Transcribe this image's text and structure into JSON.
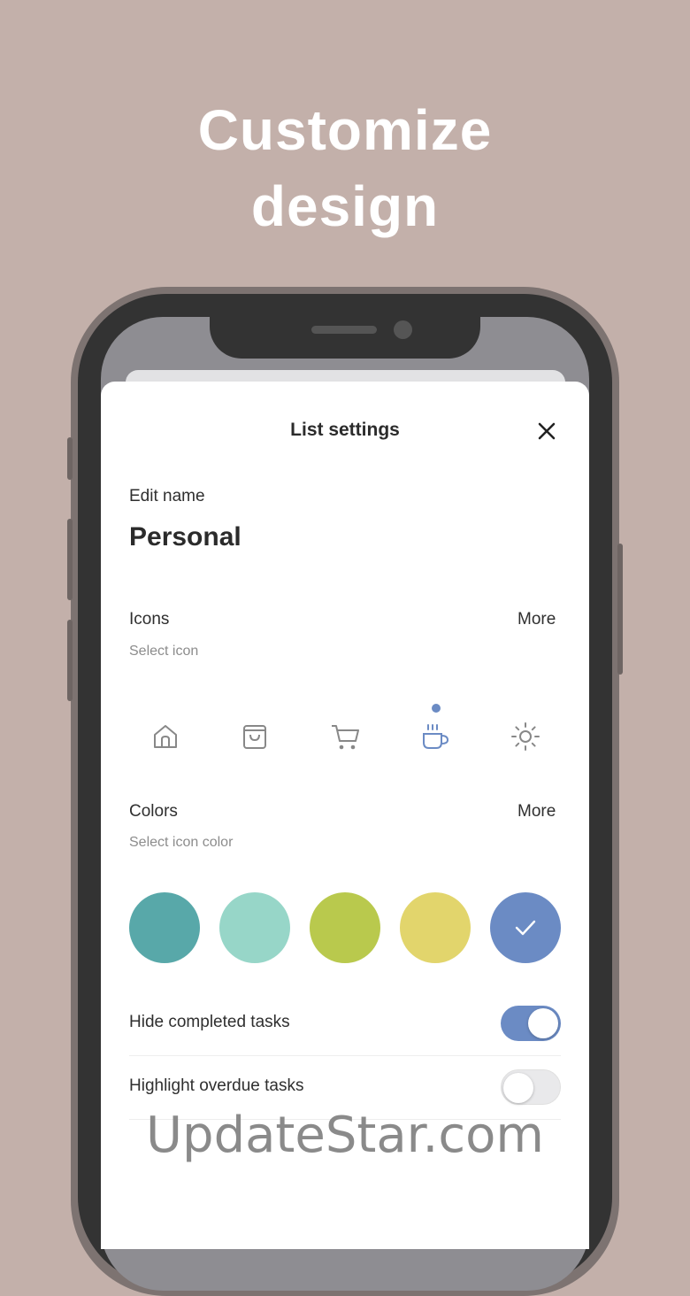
{
  "headline": {
    "line1": "Customize",
    "line2": "design"
  },
  "sheet": {
    "title": "List settings"
  },
  "edit_name": {
    "label": "Edit name",
    "value": "Personal"
  },
  "icons": {
    "label": "Icons",
    "more": "More",
    "hint": "Select icon",
    "items": [
      "home-icon",
      "bag-icon",
      "cart-icon",
      "cup-icon",
      "sun-icon"
    ],
    "selected": "cup-icon"
  },
  "colors": {
    "label": "Colors",
    "more": "More",
    "hint": "Select icon color",
    "swatches": [
      "#58a8a9",
      "#97d6c8",
      "#b9c94d",
      "#e2d56c",
      "#6b8bc4"
    ],
    "selected": "#6b8bc4"
  },
  "toggles": {
    "hide_completed": {
      "label": "Hide completed tasks",
      "on": true
    },
    "highlight_overdue": {
      "label": "Highlight overdue tasks",
      "on": false
    }
  },
  "accent_color": "#6b8bc4",
  "watermark": "UpdateStar.com"
}
